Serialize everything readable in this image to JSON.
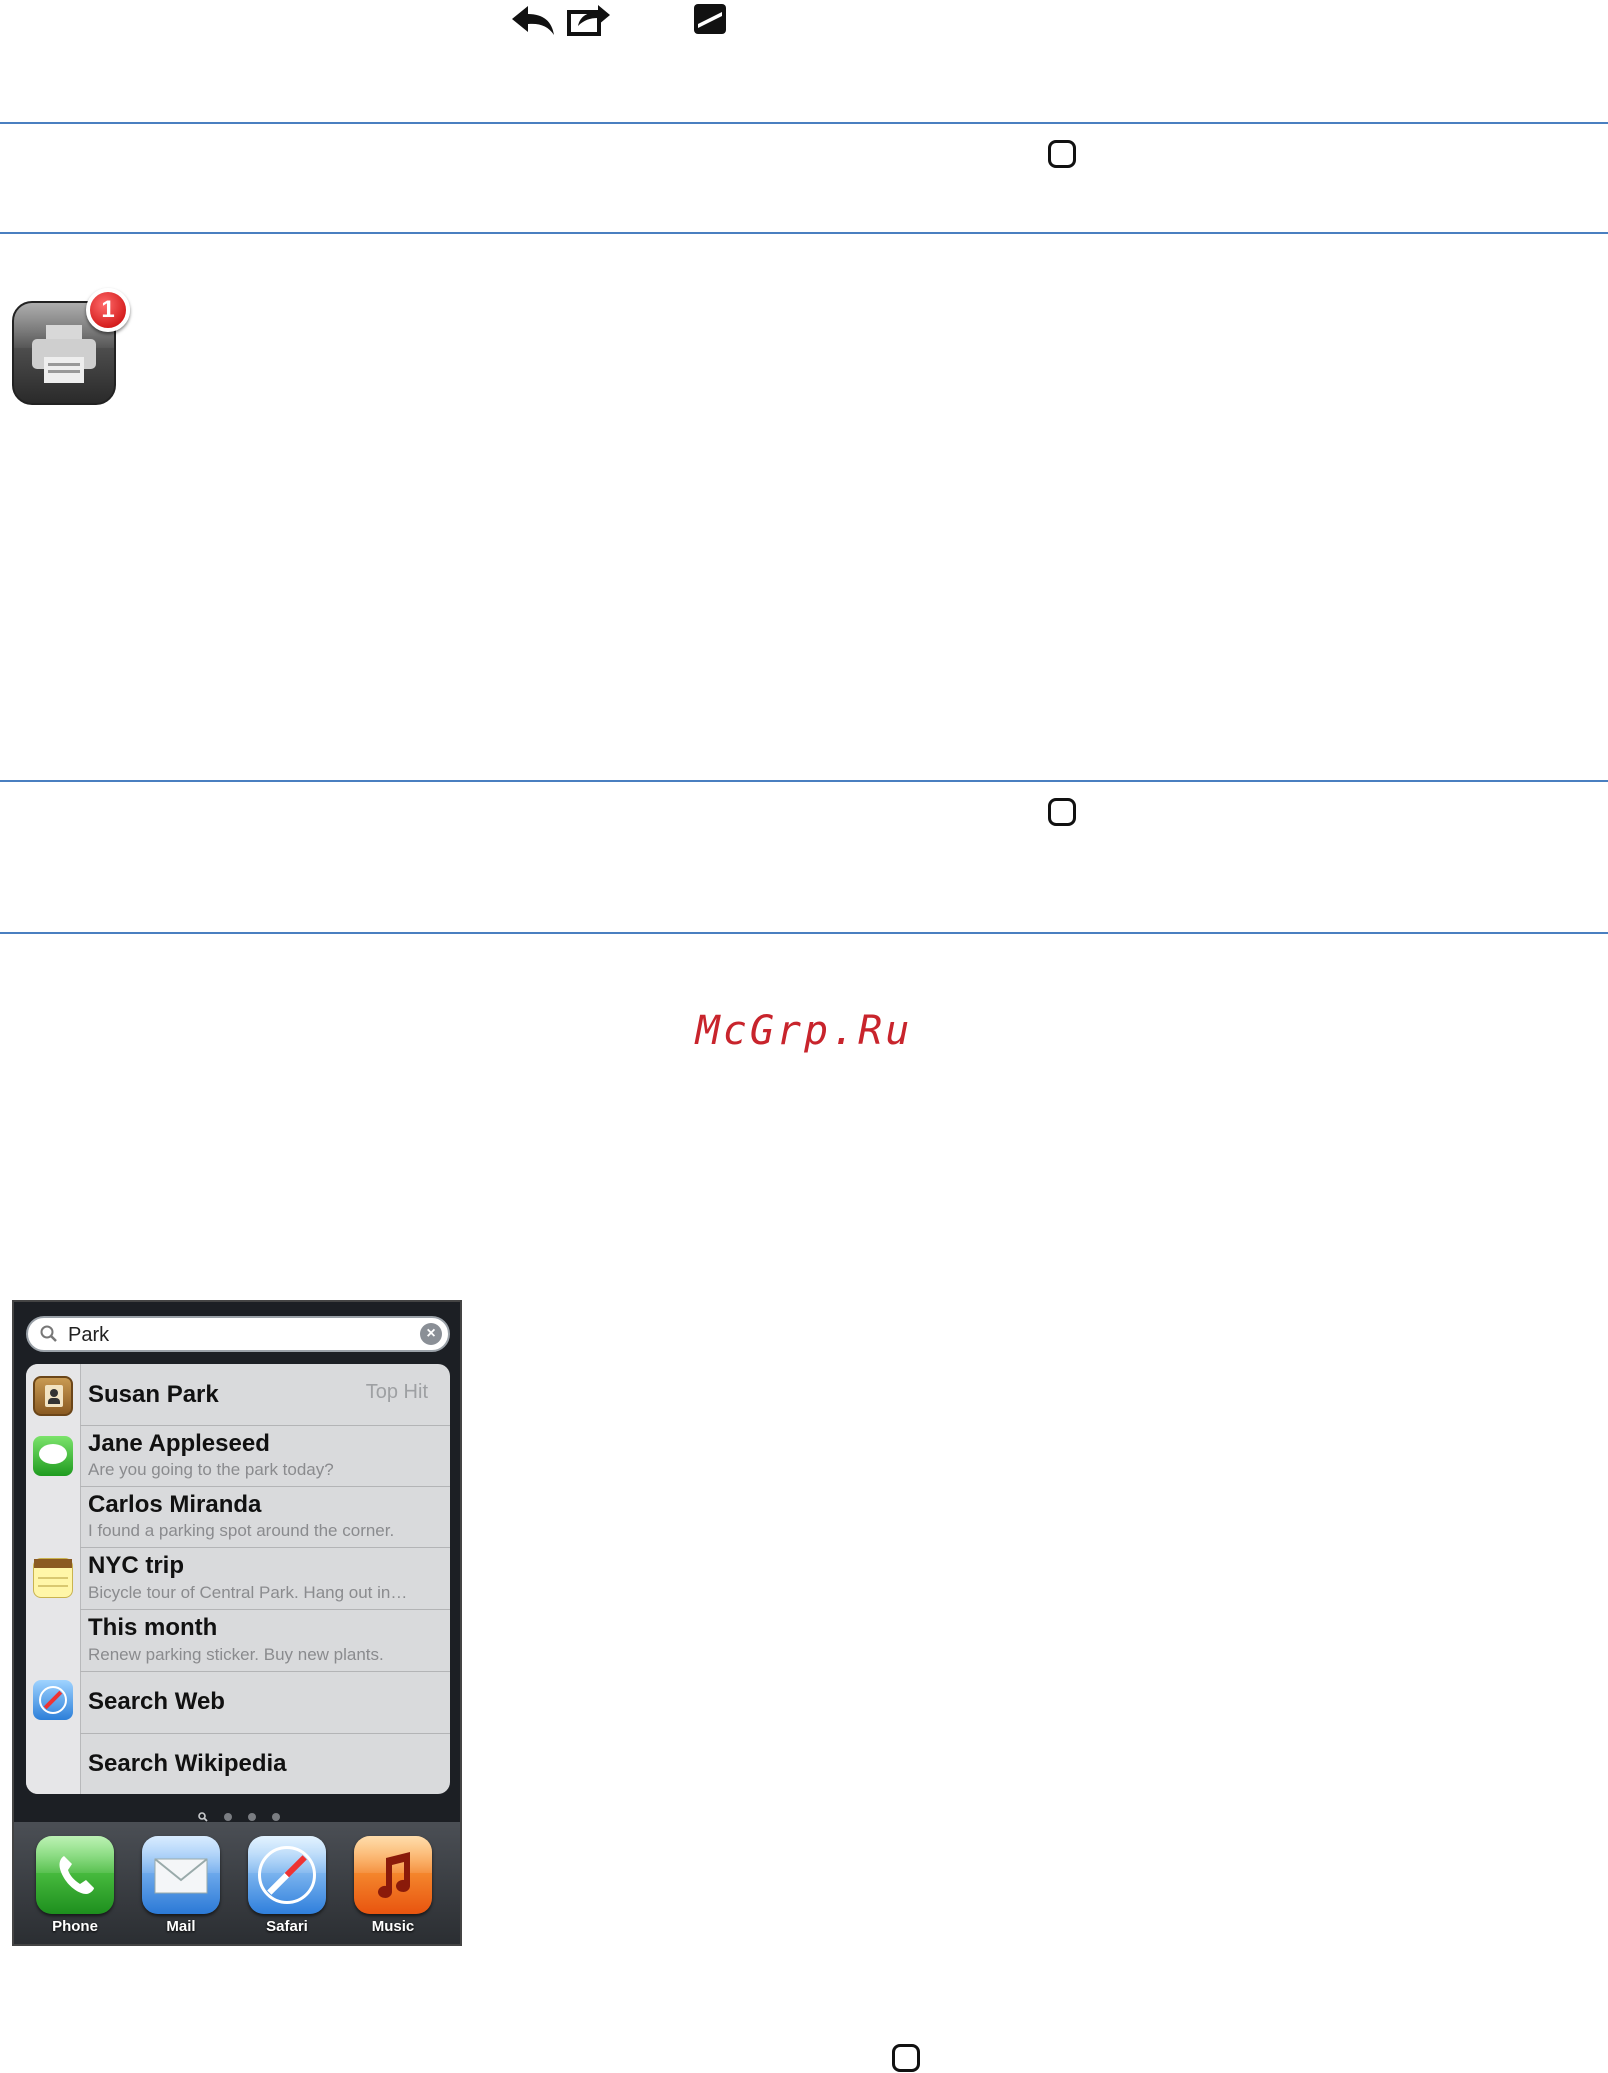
{
  "watermark": "McGrp.Ru",
  "toolbar_icons": [
    "reply-arrow-icon",
    "forward-share-icon",
    "trash-icon"
  ],
  "print_app": {
    "badge_count": "1",
    "icon": "printer-icon"
  },
  "home_button_icons": [
    "home-button-icon",
    "home-button-icon",
    "home-button-icon"
  ],
  "spotlight": {
    "search": {
      "value": "Park",
      "clear": "×"
    },
    "results": [
      {
        "app": "contacts-icon",
        "title": "Susan Park",
        "subtitle": "",
        "hint": "Top Hit"
      },
      {
        "app": "messages-icon",
        "title": "Jane Appleseed",
        "subtitle": "Are you going to the park today?"
      },
      {
        "app": "",
        "title": "Carlos Miranda",
        "subtitle": "I found a parking spot around the corner."
      },
      {
        "app": "notes-icon",
        "title": "NYC trip",
        "subtitle": "Bicycle tour of Central Park. Hang out in…"
      },
      {
        "app": "",
        "title": "This month",
        "subtitle": "Renew parking sticker. Buy new plants."
      },
      {
        "app": "safari-icon",
        "title": "Search Web",
        "subtitle": ""
      },
      {
        "app": "",
        "title": "Search Wikipedia",
        "subtitle": ""
      }
    ],
    "dock": [
      {
        "label": "Phone",
        "color": "#2fb12f"
      },
      {
        "label": "Mail",
        "color": "#4a8fdc"
      },
      {
        "label": "Safari",
        "color": "#3b8fe0"
      },
      {
        "label": "Music",
        "color": "#f0781e"
      }
    ]
  }
}
